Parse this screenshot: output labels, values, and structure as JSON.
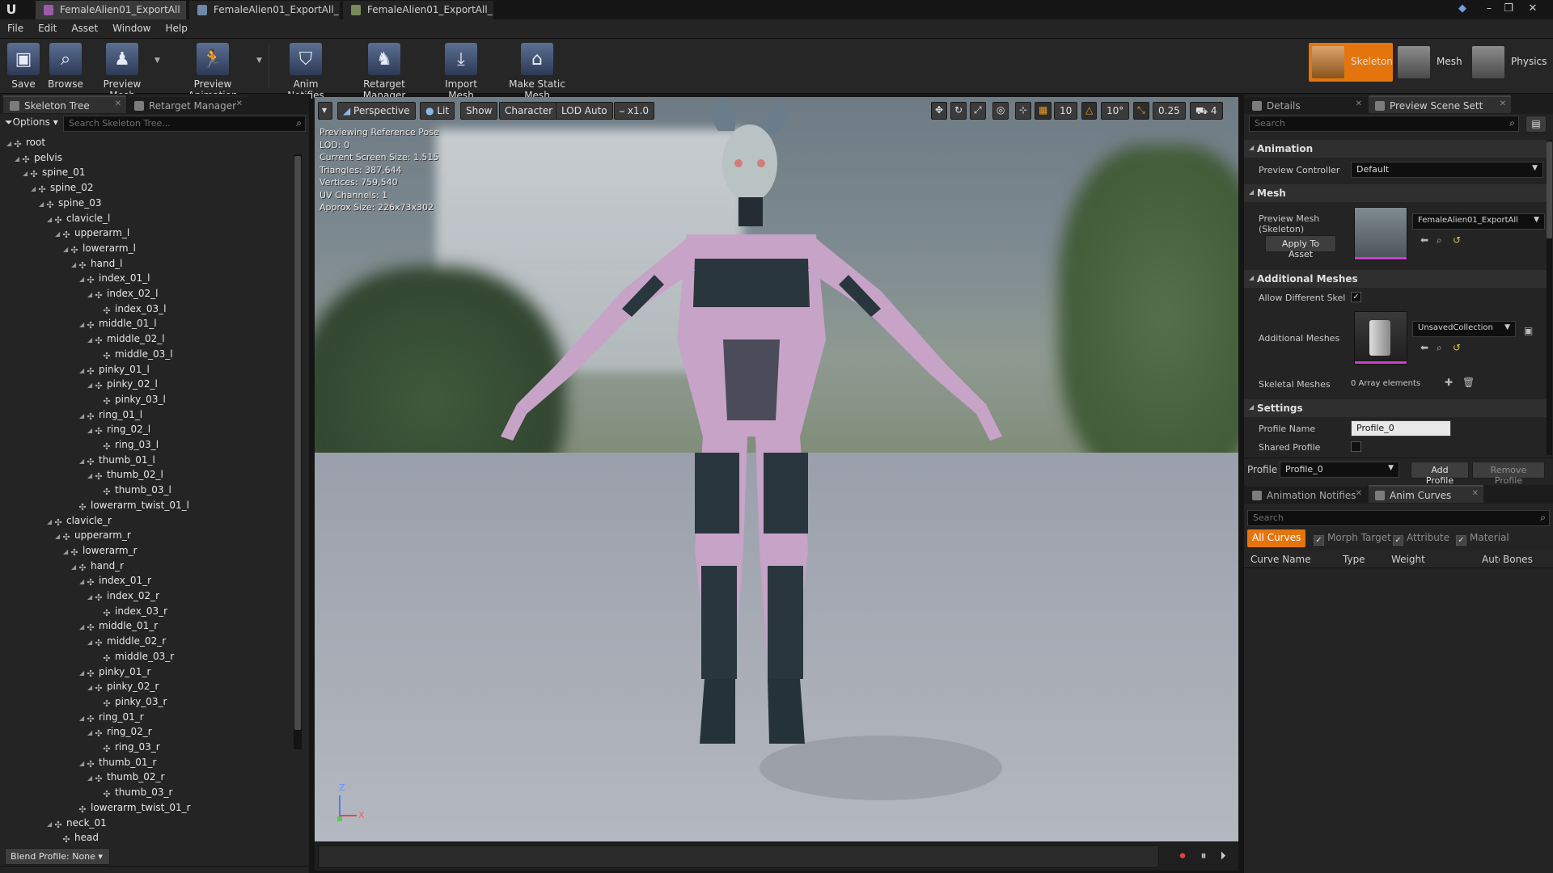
{
  "titlebar": {
    "tabs": [
      {
        "label": "FemaleAlien01_ExportAll",
        "active": true
      },
      {
        "label": "FemaleAlien01_ExportAll_",
        "active": false
      },
      {
        "label": "FemaleAlien01_ExportAll_",
        "active": false
      }
    ]
  },
  "menu": {
    "items": [
      "File",
      "Edit",
      "Asset",
      "Window",
      "Help"
    ]
  },
  "toolbar": {
    "save": "Save",
    "browse": "Browse",
    "preview_mesh": "Preview Mesh",
    "preview_animation": "Preview Animation",
    "anim_notifies": "Anim Notifies",
    "retarget_manager": "Retarget Manager",
    "import_mesh": "Import Mesh",
    "make_static_mesh": "Make Static Mesh"
  },
  "modes": {
    "skeleton": "Skeleton",
    "mesh": "Mesh",
    "physics": "Physics",
    "active": "Skeleton"
  },
  "left_panel": {
    "tabs": [
      "Skeleton Tree",
      "Retarget Manager"
    ],
    "options": "Options",
    "search_placeholder": "Search Skeleton Tree...",
    "bones": [
      {
        "name": "root",
        "depth": 0
      },
      {
        "name": "pelvis",
        "depth": 1
      },
      {
        "name": "spine_01",
        "depth": 2
      },
      {
        "name": "spine_02",
        "depth": 3
      },
      {
        "name": "spine_03",
        "depth": 4
      },
      {
        "name": "clavicle_l",
        "depth": 5
      },
      {
        "name": "upperarm_l",
        "depth": 6
      },
      {
        "name": "lowerarm_l",
        "depth": 7
      },
      {
        "name": "hand_l",
        "depth": 8
      },
      {
        "name": "index_01_l",
        "depth": 9
      },
      {
        "name": "index_02_l",
        "depth": 10
      },
      {
        "name": "index_03_l",
        "depth": 11
      },
      {
        "name": "middle_01_l",
        "depth": 9
      },
      {
        "name": "middle_02_l",
        "depth": 10
      },
      {
        "name": "middle_03_l",
        "depth": 11
      },
      {
        "name": "pinky_01_l",
        "depth": 9
      },
      {
        "name": "pinky_02_l",
        "depth": 10
      },
      {
        "name": "pinky_03_l",
        "depth": 11
      },
      {
        "name": "ring_01_l",
        "depth": 9
      },
      {
        "name": "ring_02_l",
        "depth": 10
      },
      {
        "name": "ring_03_l",
        "depth": 11
      },
      {
        "name": "thumb_01_l",
        "depth": 9
      },
      {
        "name": "thumb_02_l",
        "depth": 10
      },
      {
        "name": "thumb_03_l",
        "depth": 11
      },
      {
        "name": "lowerarm_twist_01_l",
        "depth": 8
      },
      {
        "name": "clavicle_r",
        "depth": 5
      },
      {
        "name": "upperarm_r",
        "depth": 6
      },
      {
        "name": "lowerarm_r",
        "depth": 7
      },
      {
        "name": "hand_r",
        "depth": 8
      },
      {
        "name": "index_01_r",
        "depth": 9
      },
      {
        "name": "index_02_r",
        "depth": 10
      },
      {
        "name": "index_03_r",
        "depth": 11
      },
      {
        "name": "middle_01_r",
        "depth": 9
      },
      {
        "name": "middle_02_r",
        "depth": 10
      },
      {
        "name": "middle_03_r",
        "depth": 11
      },
      {
        "name": "pinky_01_r",
        "depth": 9
      },
      {
        "name": "pinky_02_r",
        "depth": 10
      },
      {
        "name": "pinky_03_r",
        "depth": 11
      },
      {
        "name": "ring_01_r",
        "depth": 9
      },
      {
        "name": "ring_02_r",
        "depth": 10
      },
      {
        "name": "ring_03_r",
        "depth": 11
      },
      {
        "name": "thumb_01_r",
        "depth": 9
      },
      {
        "name": "thumb_02_r",
        "depth": 10
      },
      {
        "name": "thumb_03_r",
        "depth": 11
      },
      {
        "name": "lowerarm_twist_01_r",
        "depth": 8
      },
      {
        "name": "neck_01",
        "depth": 5
      },
      {
        "name": "head",
        "depth": 6
      }
    ],
    "blend_profile": "Blend Profile: None"
  },
  "viewport": {
    "perspective": "Perspective",
    "lit": "Lit",
    "show": "Show",
    "character": "Character",
    "lod": "LOD Auto",
    "speed": "x1.0",
    "grid_snap": "10",
    "rot_snap": "10°",
    "scale_snap": "0.25",
    "cam_speed": "4",
    "info": [
      "Previewing Reference Pose",
      "LOD: 0",
      "Current Screen Size: 1.515",
      "Triangles: 387,644",
      "Vertices: 759,540",
      "UV Channels: 1",
      "Approx Size: 226x73x302"
    ],
    "axis_z": "Z",
    "axis_x": "X"
  },
  "details": {
    "tabs": [
      "Details",
      "Preview Scene Sett"
    ],
    "search_placeholder": "Search",
    "animation_header": "Animation",
    "preview_controller_label": "Preview Controller",
    "preview_controller_value": "Default",
    "mesh_header": "Mesh",
    "preview_mesh_label": "Preview Mesh (Skeleton)",
    "preview_mesh_value": "FemaleAlien01_ExportAll",
    "apply_to_asset": "Apply To Asset",
    "additional_meshes_header": "Additional Meshes",
    "allow_diff_label": "Allow Different Skelet",
    "additional_meshes_label": "Additional Meshes",
    "additional_meshes_value": "UnsavedCollection",
    "skeletal_meshes_label": "Skeletal Meshes",
    "skeletal_meshes_value": "0 Array elements",
    "settings_header": "Settings",
    "profile_name_label": "Profile Name",
    "profile_name_value": "Profile_0",
    "shared_profile_label": "Shared Profile",
    "profile_label": "Profile",
    "profile_value": "Profile_0",
    "add_profile": "Add Profile",
    "remove_profile": "Remove Profile"
  },
  "curves": {
    "tabs": [
      "Animation Notifies",
      "Anim Curves"
    ],
    "search_placeholder": "Search",
    "filters": [
      "All Curves",
      "Morph Target",
      "Attribute",
      "Material"
    ],
    "columns": [
      "Curve Name",
      "Type",
      "Weight",
      "Auto",
      "Bones"
    ]
  }
}
